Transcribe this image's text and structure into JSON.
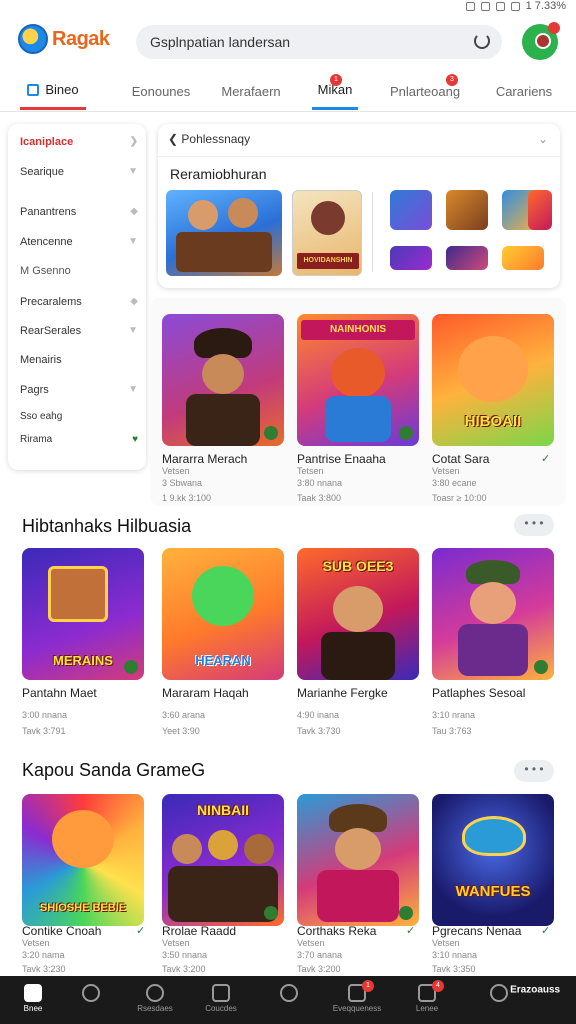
{
  "status_bar": {
    "time": "1 7.33%"
  },
  "header": {
    "logo_text": "Ragak",
    "search_value": "Gsplnpatian landersan",
    "accent": "#e8671c"
  },
  "tabs": [
    {
      "label": "Bineo"
    },
    {
      "label": "Eonounes"
    },
    {
      "label": "Merafaern"
    },
    {
      "label": "Mikan"
    },
    {
      "label": "Pnlarteoang"
    },
    {
      "label": "Carariens"
    }
  ],
  "tab_badges": {
    "mikan": "1",
    "pnlarteoang": "3"
  },
  "sidebar": {
    "items": [
      {
        "label": "Icaniplace"
      },
      {
        "label": "Searique"
      },
      {
        "label": "Panantrens"
      },
      {
        "label": "Atencenne"
      },
      {
        "label": "M Gsenno"
      },
      {
        "label": "Precaralems"
      },
      {
        "label": "RearSerales"
      },
      {
        "label": "Menairis"
      },
      {
        "label": "Pagrs"
      },
      {
        "label": "Sso eahg"
      },
      {
        "label": "Rirama"
      }
    ]
  },
  "featured": {
    "head": "Pohlessnaqy",
    "title": "Reramiobhuran",
    "banner_text": "HOVIDANSHIN"
  },
  "top_grid": [
    {
      "name": "Mararra Merach",
      "sub1": "Vetsen",
      "sub2": "3 Sbwana",
      "sub3": "1 9.kk 3:100",
      "art": ""
    },
    {
      "name": "Pantrise Enaaha",
      "sub1": "Tetsen",
      "sub2": "3:80 nnana",
      "sub3": "Taak 3:800",
      "art": "NAINHONIS"
    },
    {
      "name": "Cotat Sara",
      "sub1": "Vetsen",
      "sub2": "3:80 ecane",
      "sub3": "Toasr ≥ 10:00",
      "art": "HIBOAII"
    }
  ],
  "section1": {
    "title": "Hibtanhaks Hilbuasia",
    "more": "• • •",
    "tiles": [
      {
        "name": "Pantahn Maet",
        "sub1": "3:00 nnana",
        "sub2": "Tavk 3:791",
        "art": "MERAINS"
      },
      {
        "name": "Mararam Haqah",
        "sub1": "3:60 arana",
        "sub2": "Yeet 3:90",
        "art": "HEARAN"
      },
      {
        "name": "Marianhe Fergke",
        "sub1": "4:90 inana",
        "sub2": "Tavk 3:730",
        "art": "SUB OEE3"
      },
      {
        "name": "Patlaphes Sesoal",
        "sub1": "3:10 nrana",
        "sub2": "Tau 3:763",
        "art": ""
      }
    ]
  },
  "section2": {
    "title": "Kapou Sanda GrameG",
    "more": "• • •",
    "tiles": [
      {
        "name": "Contike Cnoah",
        "sub1": "Vetsen",
        "sub2": "3:20 nama",
        "sub3": "Tavk 3:230",
        "art": "SHIOSHE BEBIE"
      },
      {
        "name": "Rrolae Raadd",
        "sub1": "Vetsen",
        "sub2": "3:50 nnana",
        "sub3": "Tavk 3:200",
        "art": "NINBAII"
      },
      {
        "name": "Corthaks Reka",
        "sub1": "Vetsen",
        "sub2": "3:70 anana",
        "sub3": "Tavk 3:200",
        "art": ""
      },
      {
        "name": "Pgrecans Nenaa",
        "sub1": "Vetsen",
        "sub2": "3:10 nnana",
        "sub3": "Tavk 3:350",
        "art": "WANFUES"
      }
    ]
  },
  "bottom_nav": [
    {
      "label": "Bnee"
    },
    {
      "label": ""
    },
    {
      "label": "Rsesdaes"
    },
    {
      "label": "Coucdes"
    },
    {
      "label": ""
    },
    {
      "label": "Eveqqueness"
    },
    {
      "label": "Lenee"
    },
    {
      "label": "Erazoauss"
    }
  ],
  "bottom_badges": {
    "eveqqueness": "1",
    "lenee": "4"
  }
}
